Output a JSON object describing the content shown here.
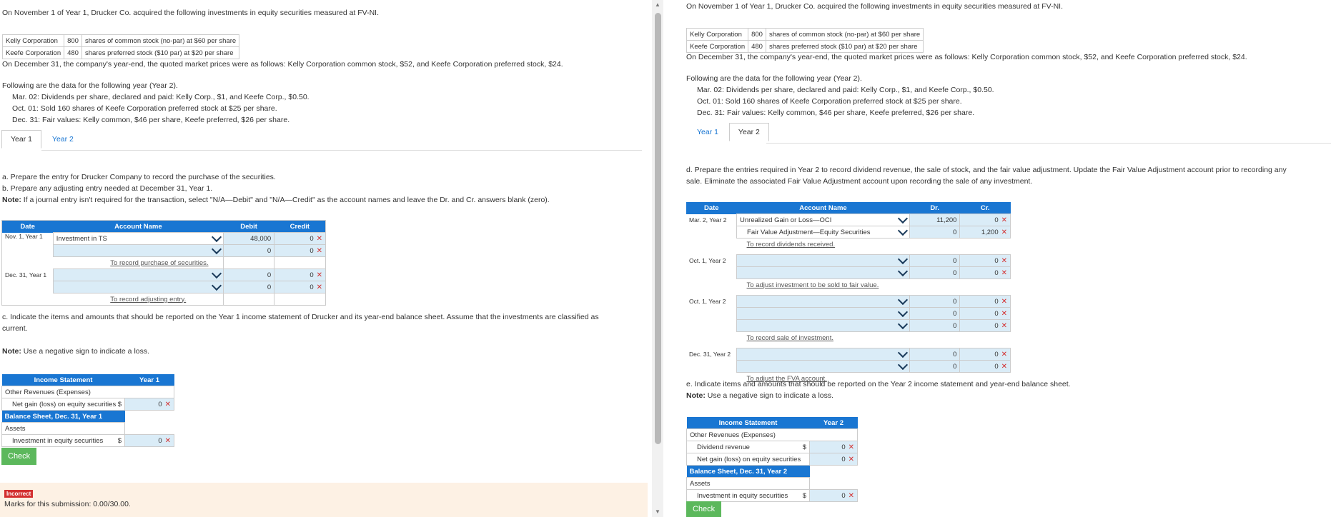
{
  "left": {
    "intro": "On November 1 of Year 1, Drucker Co. acquired the following investments in equity securities measured at FV-NI.",
    "securities": [
      {
        "company": "Kelly Corporation",
        "qty": "800",
        "desc": "shares of common stock (no-par) at $60 per share"
      },
      {
        "company": "Keefe Corporation",
        "qty": "480",
        "desc": "shares preferred stock ($10 par) at $20 per share"
      }
    ],
    "dec31": "On December 31, the company's year-end, the quoted market prices were as follows: Kelly Corporation common stock, $52, and Keefe Corporation preferred stock, $24.",
    "following": "Following are the data for the following year (Year 2).",
    "events": [
      "Mar. 02: Dividends per share, declared and paid: Kelly Corp., $1, and Keefe Corp., $0.50.",
      "Oct. 01: Sold 160 shares of Keefe Corporation preferred stock at $25 per share.",
      "Dec. 31: Fair values: Kelly common, $46 per share, Keefe preferred, $26 per share."
    ],
    "tabs": [
      "Year 1",
      "Year 2"
    ],
    "instr_a": "a. Prepare the entry for Drucker Company to record the purchase of the securities.",
    "instr_b": "b. Prepare any adjusting entry needed at December 31, Year 1.",
    "note_label": "Note:",
    "note_text": " If a journal entry isn't required for the transaction, select \"N/A—Debit\" and \"N/A—Credit\" as the account names and leave the Dr. and Cr. answers blank (zero).",
    "journal_headers": [
      "Date",
      "Account Name",
      "Debit",
      "Credit"
    ],
    "journal": {
      "d1": "Nov. 1, Year 1",
      "r1_acct": "Investment in TS",
      "r1_debit": "48,000",
      "r1_credit": "0",
      "r2_debit": "0",
      "r2_credit": "0",
      "memo1": "To record purchase of securities.",
      "d2": "Dec. 31, Year 1",
      "r3_debit": "0",
      "r3_credit": "0",
      "r4_debit": "0",
      "r4_credit": "0",
      "memo2": "To record adjusting entry."
    },
    "instr_c": "c. Indicate the items and amounts that should be reported on the Year 1 income statement of Drucker and its year-end balance sheet. Assume that the investments are classified as",
    "instr_c2": "current.",
    "note2_label": "Note:",
    "note2_text": " Use a negative sign to indicate a loss.",
    "is": {
      "header": "Income Statement",
      "year": "Year 1",
      "other_rev": "Other Revenues (Expenses)",
      "net_gain": "Net gain (loss) on equity securities",
      "net_gain_cur": "$",
      "net_gain_val": "0",
      "bs_header": "Balance Sheet, Dec. 31, Year 1",
      "assets": "Assets",
      "inv": "Investment in equity securities",
      "inv_cur": "$",
      "inv_val": "0"
    },
    "check": "Check",
    "incorrect": "Incorrect",
    "marks": "Marks for this submission: 0.00/30.00."
  },
  "right": {
    "intro": "On November 1 of Year 1, Drucker Co. acquired the following investments in equity securities measured at FV-NI.",
    "securities": [
      {
        "company": "Kelly Corporation",
        "qty": "800",
        "desc": "shares of common stock (no-par) at $60 per share"
      },
      {
        "company": "Keefe Corporation",
        "qty": "480",
        "desc": "shares preferred stock ($10 par) at $20 per share"
      }
    ],
    "dec31": "On December 31, the company's year-end, the quoted market prices were as follows: Kelly Corporation common stock, $52, and Keefe Corporation preferred stock, $24.",
    "following": "Following are the data for the following year (Year 2).",
    "events": [
      "Mar. 02: Dividends per share, declared and paid: Kelly Corp., $1, and Keefe Corp., $0.50.",
      "Oct. 01: Sold 160 shares of Keefe Corporation preferred stock at $25 per share.",
      "Dec. 31: Fair values: Kelly common, $46 per share, Keefe preferred, $26 per share."
    ],
    "tabs": [
      "Year 1",
      "Year 2"
    ],
    "instr_d": "d. Prepare the entries required in Year 2 to record dividend revenue, the sale of stock, and the fair value adjustment. Update the Fair Value Adjustment account prior to recording any",
    "instr_d2": "sale. Eliminate the associated Fair Value Adjustment account upon recording the sale of any investment.",
    "journal_headers": [
      "Date",
      "Account Name",
      "Dr.",
      "Cr."
    ],
    "journal": {
      "d1": "Mar. 2, Year 2",
      "r1_acct": "Unrealized Gain or Loss—OCI",
      "r1_dr": "11,200",
      "r1_cr": "0",
      "r2_acct": "Fair Value Adjustment—Equity Securities",
      "r2_dr": "0",
      "r2_cr": "1,200",
      "memo1": "To record dividends received.",
      "d2": "Oct. 1, Year 2",
      "r3_dr": "0",
      "r3_cr": "0",
      "r4_dr": "0",
      "r4_cr": "0",
      "memo2": "To adjust investment to be sold to fair value.",
      "d3": "Oct. 1, Year 2",
      "r5_dr": "0",
      "r5_cr": "0",
      "r6_dr": "0",
      "r6_cr": "0",
      "r7_dr": "0",
      "r7_cr": "0",
      "memo3": "To record sale of investment.",
      "d4": "Dec. 31, Year 2",
      "r8_dr": "0",
      "r8_cr": "0",
      "r9_dr": "0",
      "r9_cr": "0",
      "memo4": "To adjust the FVA account."
    },
    "instr_e": "e. Indicate items and amounts that should be reported on the Year 2 income statement and year-end balance sheet.",
    "note_label": "Note:",
    "note_text": " Use a negative sign to indicate a loss.",
    "is": {
      "header": "Income Statement",
      "year": "Year 2",
      "other_rev": "Other Revenues (Expenses)",
      "div_rev": "Dividend revenue",
      "div_cur": "$",
      "div_val": "0",
      "net_gain": "Net gain (loss) on equity securities",
      "net_gain_val": "0",
      "bs_header": "Balance Sheet, Dec. 31, Year 2",
      "assets": "Assets",
      "inv": "Investment in equity securities",
      "inv_cur": "$",
      "inv_val": "0"
    },
    "check": "Check"
  },
  "colors": {
    "accent": "#1976d2",
    "input_bg": "#daecf7",
    "error": "#d32f2f",
    "check": "#5cb85c",
    "banner": "#fdf1e4"
  }
}
